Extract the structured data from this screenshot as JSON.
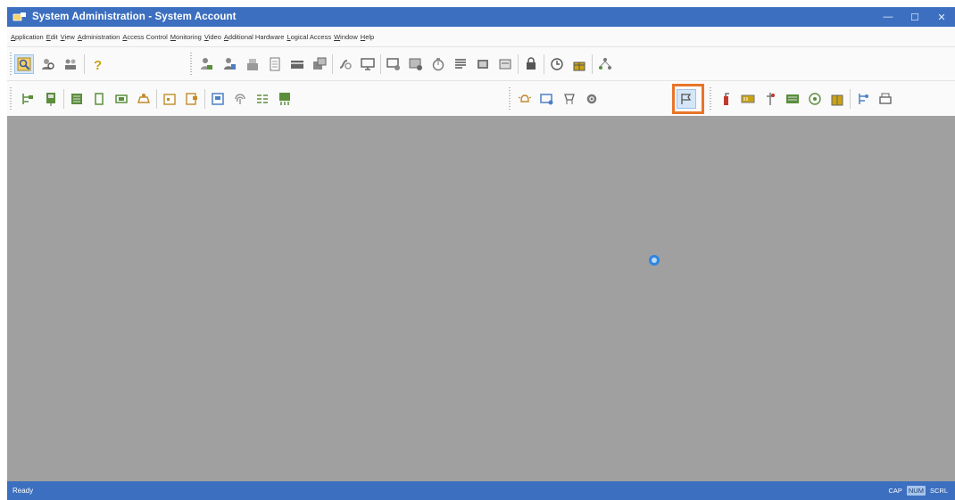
{
  "window": {
    "title": "System Administration - System Account",
    "controls": [
      "—",
      "☐",
      "✕"
    ]
  },
  "menu": [
    "Application",
    "Edit",
    "View",
    "Administration",
    "Access Control",
    "Monitoring",
    "Video",
    "Additional Hardware",
    "Logical Access",
    "Window",
    "Help"
  ],
  "status": {
    "text": "Ready",
    "indicators": [
      "CAP",
      "NUM",
      "SCRL"
    ]
  },
  "colors": {
    "titlebar": "#3c6fbf",
    "workspace": "#a0a0a0",
    "highlight": "#e8752a"
  }
}
